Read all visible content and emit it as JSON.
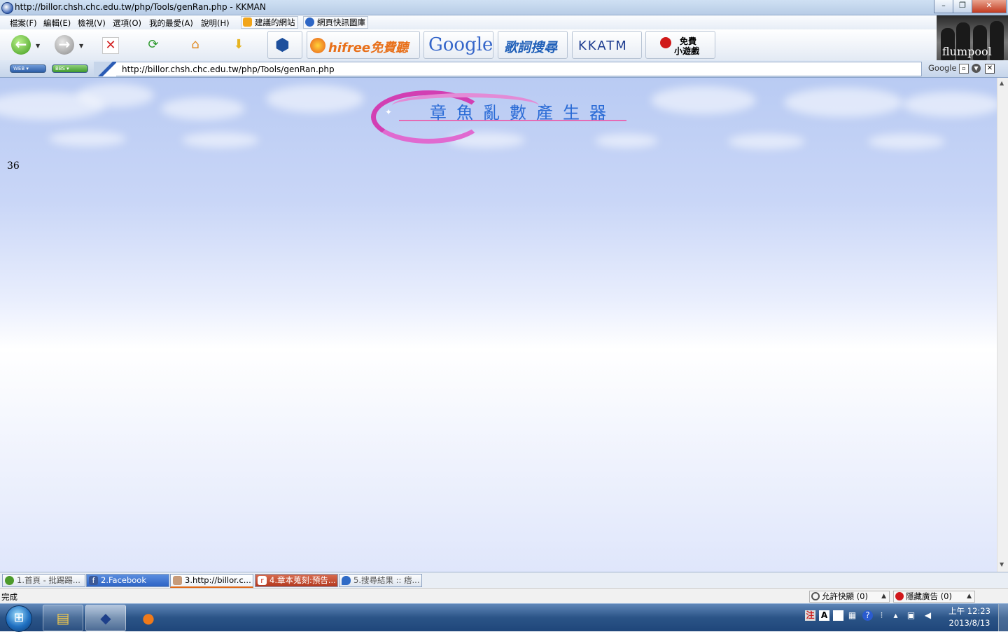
{
  "window": {
    "title": "http://billor.chsh.chc.edu.tw/php/Tools/genRan.php - KKMAN",
    "controls": [
      "–",
      "❐",
      "✕"
    ]
  },
  "menu": {
    "items": [
      "檔案(F)",
      "編輯(E)",
      "檢視(V)",
      "選項(O)",
      "我的最愛(A)",
      "說明(H)"
    ],
    "favorites": [
      "建議的網站",
      "網頁快訊圖庫"
    ]
  },
  "toolbar": {
    "banners": {
      "hifree": "hifree免費聽歌",
      "google": "Google",
      "lyrics": "歌詞搜尋",
      "kkatm": "KKATM",
      "games_line1": "免費",
      "games_line2": "小遊戲"
    }
  },
  "address_bar": {
    "web_label": "WEB",
    "bbs_label": "BBS",
    "url": "http://billor.chsh.chc.edu.tw/php/Tools/genRan.php",
    "search_engine": "Google"
  },
  "artist_caption": "flumpool",
  "page": {
    "logo_text": "章魚亂數產生器",
    "random_number": "36"
  },
  "tabs": [
    {
      "label": "1.首頁 - 批踢踢...",
      "icon_color": "#4c9a2a",
      "active": false
    },
    {
      "label": "2.Facebook",
      "icon_color": "#3b5998",
      "active": false
    },
    {
      "label": "3.http://billor.c...",
      "icon_color": "#c79b7a",
      "active": true
    },
    {
      "label": "4.章本蒐刻:預告...",
      "icon_color": "#c8321e",
      "active": false
    },
    {
      "label": "5.搜尋結果 :: 痞...",
      "icon_color": "#2f6ac6",
      "active": false
    }
  ],
  "statusbar": {
    "status": "完成",
    "popup_label": "允許快顯 (0)",
    "ads_label": "隱藏廣告 (0)"
  },
  "taskbar": {
    "time": "上午 12:23",
    "date": "2013/8/13"
  },
  "colors": {
    "logo_blue": "#2a6bd6",
    "logo_pink": "#d23fb3",
    "taskbar": "#2b5487"
  }
}
